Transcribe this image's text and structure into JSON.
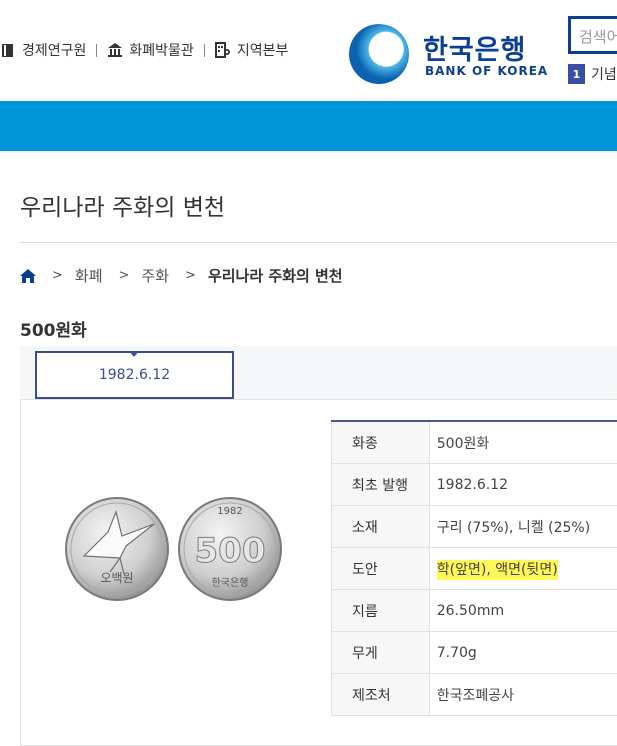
{
  "header": {
    "links": [
      {
        "label": "경제연구원",
        "icon": "book-icon"
      },
      {
        "label": "화폐박물관",
        "icon": "museum-icon"
      },
      {
        "label": "지역본부",
        "icon": "region-icon"
      }
    ],
    "logo": {
      "korean": "한국은행",
      "english": "BANK OF KOREA"
    },
    "search_placeholder": "검색어",
    "rank": {
      "number": "1",
      "text": "기념"
    }
  },
  "colors": {
    "brand_blue": "#0095d9",
    "navy": "#0b3f92",
    "tab": "#3d4c8c",
    "highlight": "#fff65a"
  },
  "page_title": "우리나라 주화의 변천",
  "breadcrumb": {
    "items": [
      "화폐",
      "주화"
    ],
    "current": "우리나라 주화의 변천"
  },
  "section_title": "500원화",
  "tabs": [
    {
      "label": "1982.6.12",
      "active": true
    }
  ],
  "coin": {
    "front_text": "오백원",
    "back_value": "500",
    "back_year": "1982",
    "back_text": "한국은행"
  },
  "spec_table": [
    {
      "label": "화종",
      "value": "500원화"
    },
    {
      "label": "최초 발행",
      "value": "1982.6.12"
    },
    {
      "label": "소재",
      "value": "구리 (75%), 니켈 (25%)"
    },
    {
      "label": "도안",
      "value": "학(앞면), 액면(뒷면)"
    },
    {
      "label": "지름",
      "value": "26.50mm"
    },
    {
      "label": "무게",
      "value": "7.70g"
    },
    {
      "label": "제조처",
      "value": "한국조폐공사"
    }
  ]
}
